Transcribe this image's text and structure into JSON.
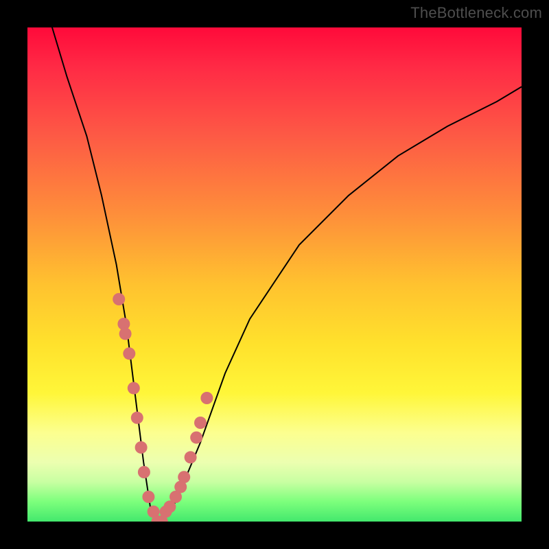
{
  "watermark": "TheBottleneck.com",
  "chart_data": {
    "type": "line",
    "title": "",
    "xlabel": "",
    "ylabel": "",
    "xlim": [
      0,
      100
    ],
    "ylim": [
      0,
      100
    ],
    "grid": false,
    "series": [
      {
        "name": "bottleneck-curve",
        "x": [
          0,
          5,
          8,
          12,
          15,
          18,
          20,
          22,
          23.5,
          25,
          27,
          30,
          35,
          40,
          45,
          55,
          65,
          75,
          85,
          95,
          100
        ],
        "values": [
          110,
          100,
          90,
          78,
          66,
          52,
          40,
          24,
          12,
          2,
          0,
          4,
          16,
          30,
          41,
          56,
          66,
          74,
          80,
          85,
          88
        ]
      }
    ],
    "markers": {
      "name": "data-points",
      "x": [
        18.5,
        19.5,
        19.8,
        20.6,
        21.5,
        22.2,
        23.0,
        23.6,
        24.5,
        25.5,
        26.3,
        27.2,
        28.0,
        28.8,
        30.0,
        31.0,
        31.7,
        33.0,
        34.2,
        35.0,
        36.3
      ],
      "values": [
        45,
        40,
        38,
        34,
        27,
        21,
        15,
        10,
        5,
        2,
        0,
        0,
        2,
        3,
        5,
        7,
        9,
        13,
        17,
        20,
        25
      ]
    },
    "colors": {
      "curve": "#000000",
      "markers": "#d87171",
      "gradient_stops": [
        "#ff0a3a",
        "#fd5a45",
        "#fe8f3a",
        "#ffc22f",
        "#ffe12c",
        "#fff639",
        "#fcff8f",
        "#c8ffa2",
        "#43e86d"
      ]
    }
  }
}
